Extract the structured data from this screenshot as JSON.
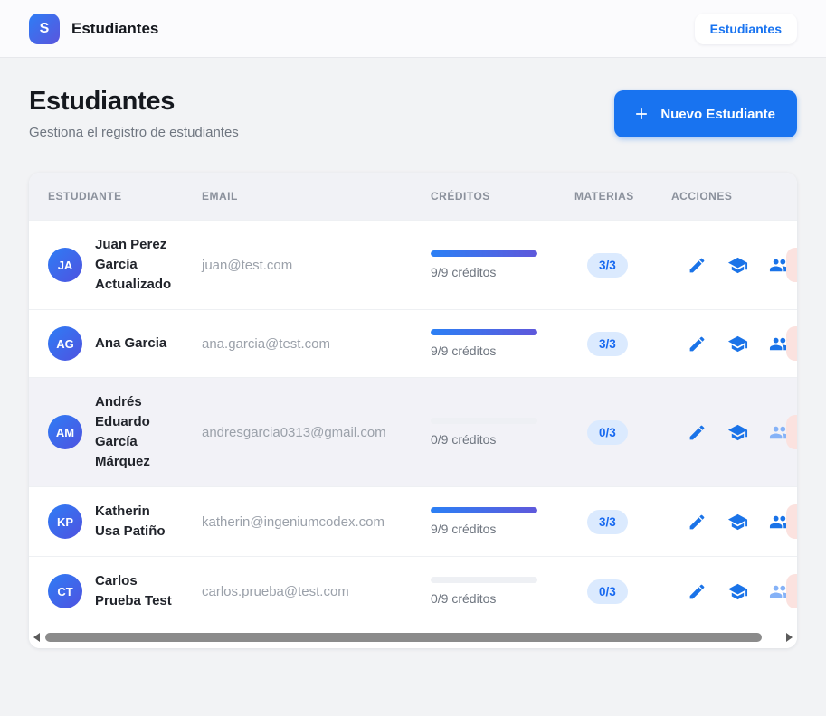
{
  "header": {
    "logo_letter": "S",
    "app_title": "Estudiantes",
    "nav_button_label": "Estudiantes"
  },
  "page": {
    "title": "Estudiantes",
    "subtitle": "Gestiona el registro de estudiantes",
    "new_student_button_label": "Nuevo Estudiante"
  },
  "table": {
    "columns": [
      "Estudiante",
      "Email",
      "Créditos",
      "Materias",
      "Acciones"
    ],
    "rows": [
      {
        "initials": "JA",
        "name": "Juan Perez García Actualizado",
        "email": "juan@test.com",
        "credits_label": "9/9 créditos",
        "credits_pct": 100,
        "materias": "3/3",
        "people_enabled": true,
        "highlighted": false
      },
      {
        "initials": "AG",
        "name": "Ana Garcia",
        "email": "ana.garcia@test.com",
        "credits_label": "9/9 créditos",
        "credits_pct": 100,
        "materias": "3/3",
        "people_enabled": true,
        "highlighted": false
      },
      {
        "initials": "AM",
        "name": "Andrés Eduardo García Márquez",
        "email": "andresgarcia0313@gmail.com",
        "credits_label": "0/9 créditos",
        "credits_pct": 0,
        "materias": "0/3",
        "people_enabled": false,
        "highlighted": true
      },
      {
        "initials": "KP",
        "name": "Katherin Usa Patiño",
        "email": "katherin@ingeniumcodex.com",
        "credits_label": "9/9 créditos",
        "credits_pct": 100,
        "materias": "3/3",
        "people_enabled": true,
        "highlighted": false
      },
      {
        "initials": "CT",
        "name": "Carlos Prueba Test",
        "email": "carlos.prueba@test.com",
        "credits_label": "0/9 créditos",
        "credits_pct": 0,
        "materias": "0/3",
        "people_enabled": false,
        "highlighted": false
      }
    ]
  },
  "icons": {
    "logo": "app-logo",
    "plus": "plus-icon",
    "edit": "pencil-icon",
    "subjects": "graduation-cap-icon",
    "groups": "people-icon",
    "delete": "delete-button-peek",
    "scroll_left": "left-arrow-icon",
    "scroll_right": "right-arrow-icon"
  },
  "colors": {
    "accent_blue": "#1873f0",
    "icon_blue": "#1a73e8",
    "icon_blue_muted": "#85b2f7",
    "progress_gradient_start": "#2b80f5",
    "progress_gradient_end": "#5f58db",
    "badge_bg": "#dbeafe",
    "badge_text": "#1769f0",
    "row_highlight_bg": "#f2f2f7",
    "delete_peek_bg": "#fbe2df",
    "page_bg": "#f2f3f5",
    "appbar_bg": "#fbfbfd"
  }
}
